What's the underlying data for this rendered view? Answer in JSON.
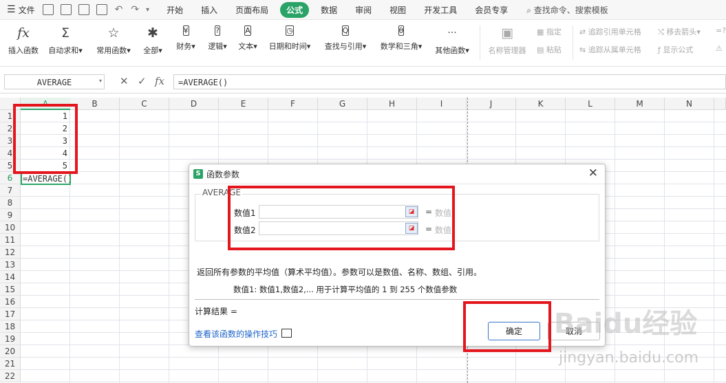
{
  "menubar": {
    "file_label": "文件",
    "tabs": [
      {
        "label": "开始"
      },
      {
        "label": "插入"
      },
      {
        "label": "页面布局"
      },
      {
        "label": "公式"
      },
      {
        "label": "数据"
      },
      {
        "label": "审阅"
      },
      {
        "label": "视图"
      },
      {
        "label": "开发工具"
      },
      {
        "label": "会员专享"
      }
    ],
    "active_tab": "公式",
    "search_label": "查找命令、搜索模板"
  },
  "ribbon": {
    "buttons": [
      {
        "label": "插入函数",
        "icon": "fx"
      },
      {
        "label": "自动求和",
        "icon": "Σ"
      },
      {
        "label": "常用函数",
        "icon": "☆"
      },
      {
        "label": "全部",
        "icon": "✱"
      },
      {
        "label": "财务",
        "icon": "¥"
      },
      {
        "label": "逻辑",
        "icon": "?"
      },
      {
        "label": "文本",
        "icon": "A"
      },
      {
        "label": "日期和时间",
        "icon": "◷"
      },
      {
        "label": "查找与引用",
        "icon": "Q"
      },
      {
        "label": "数学和三角",
        "icon": "θ"
      },
      {
        "label": "其他函数",
        "icon": "···"
      },
      {
        "label": "名称管理器",
        "icon": "▣"
      }
    ],
    "small": {
      "specify": "指定",
      "paste": "粘贴",
      "trace_precedents": "追踪引用单元格",
      "trace_dependents": "追踪从属单元格",
      "remove_arrows": "移去箭头",
      "show_formulas": "显示公式"
    }
  },
  "formula_bar": {
    "name_box": "AVERAGE",
    "cancel_icon": "✕",
    "confirm_icon": "✓",
    "fx_label": "fx",
    "formula": "=AVERAGE()"
  },
  "sheet": {
    "columns": [
      "A",
      "B",
      "C",
      "D",
      "E",
      "F",
      "G",
      "H",
      "I",
      "J",
      "K",
      "L",
      "M",
      "N"
    ],
    "rows": [
      "1",
      "2",
      "3",
      "4",
      "5",
      "6",
      "7",
      "8",
      "9",
      "10",
      "11",
      "12",
      "13",
      "14",
      "15",
      "16",
      "17",
      "18",
      "19",
      "20",
      "21",
      "22"
    ],
    "values": {
      "a1": "1",
      "a2": "2",
      "a3": "3",
      "a4": "4",
      "a5": "5",
      "a6": "=AVERAGE()"
    }
  },
  "dialog": {
    "logo": "S",
    "title": "函数参数",
    "close": "✕",
    "func_name": "AVERAGE",
    "args": [
      {
        "label": "数值1",
        "eq": "=",
        "result": "数值"
      },
      {
        "label": "数值2",
        "eq": "=",
        "result": "数值"
      }
    ],
    "description": "返回所有参数的平均值（算术平均值）。参数可以是数值、名称、数组、引用。",
    "arg_help": "数值1:   数值1,数值2,... 用于计算平均值的 1 到 255 个数值参数",
    "result_label": "计算结果 =",
    "tips_link": "查看该函数的操作技巧",
    "ok": "确定",
    "cancel": "取消"
  },
  "watermark": {
    "brand": "Baidu经验",
    "url": "jingyan.baidu.com"
  }
}
